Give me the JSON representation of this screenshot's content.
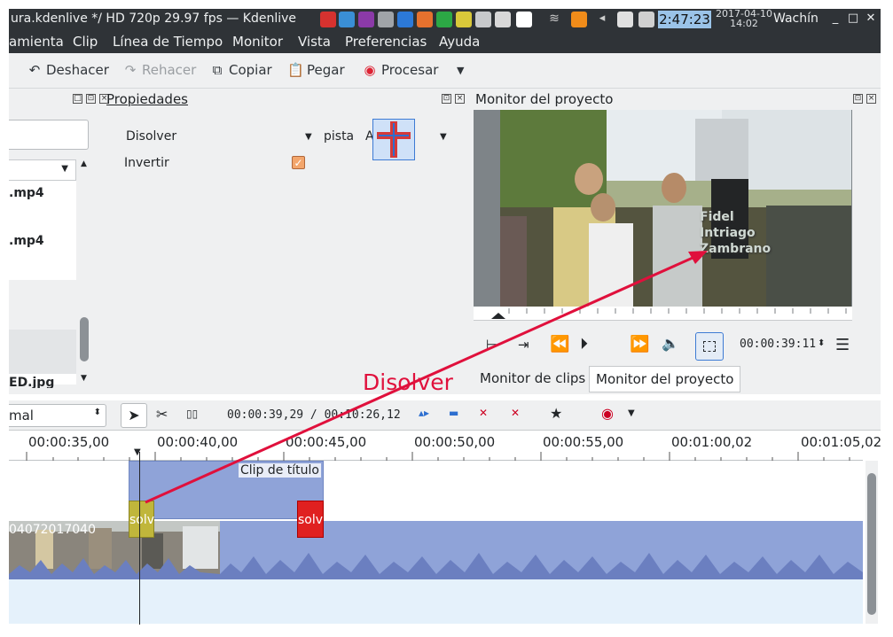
{
  "titlebar": {
    "title": "ura.kdenlive */ HD 720p 29.97 fps — Kdenlive",
    "clock": "2:47:23",
    "date": "2017-04-10",
    "time": "14:02",
    "user": "Wachín",
    "minimize": "_",
    "maximize": "□",
    "close": "✕"
  },
  "menu": [
    "amienta",
    "Clip",
    "Línea de Tiempo",
    "Monitor",
    "Vista",
    "Preferencias",
    "Ayuda"
  ],
  "toolbar": {
    "undo": "Deshacer",
    "redo": "Rehacer",
    "copy": "Copiar",
    "paste": "Pegar",
    "render": "Procesar"
  },
  "bin": {
    "items": [
      ".mp4",
      ".mp4",
      "ED.jpg"
    ]
  },
  "properties": {
    "title": "Propiedades",
    "transition": "Disolver",
    "track_label": "pista",
    "track_value": "A",
    "invert": "Invertir"
  },
  "monitor": {
    "title": "Monitor del proyecto",
    "overlay": [
      "Fidel",
      "Intriago",
      "Zambrano"
    ],
    "timecode": "00:00:39:11",
    "tabs": [
      "Monitor de clips",
      "Monitor del proyecto"
    ]
  },
  "timeline": {
    "mode": "mal",
    "timecode": "00:00:39,29 / 00:10:26,12",
    "ruler": [
      "00:00:35,00",
      "00:00:40,00",
      "00:00:45,00",
      "00:00:50,00",
      "00:00:55,00",
      "00:01:00,02",
      "00:01:05,02"
    ],
    "title_clip": "Clip de título",
    "transition_label": "solv",
    "video_clip_name": "04072017040"
  },
  "annotation": "Disolver",
  "colors": {
    "accent": "#3d7bd4",
    "transition_red": "#e02020",
    "clip_blue": "#8fa3d8",
    "annotation": "#e0103c"
  }
}
